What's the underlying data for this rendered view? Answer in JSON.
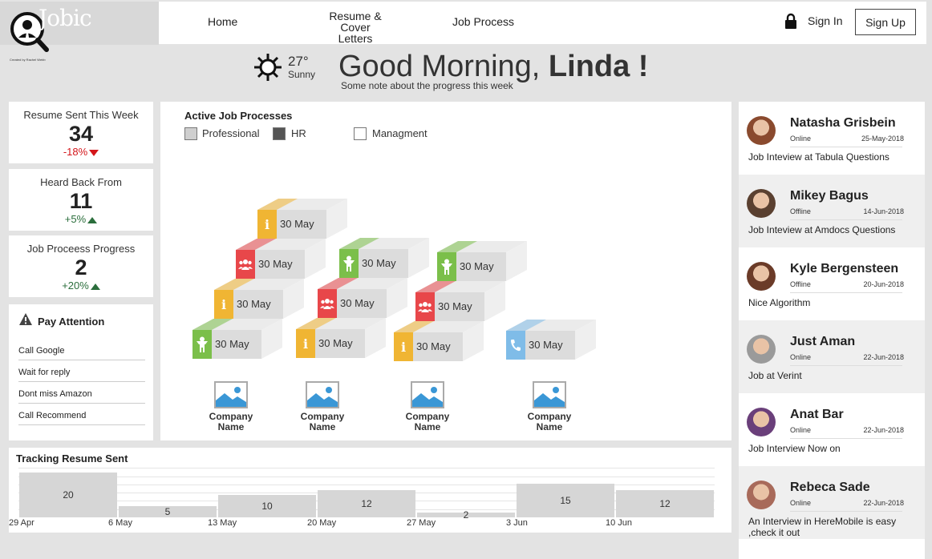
{
  "brand": {
    "name": "Jobic",
    "tagline": "Created by Rachel Webb"
  },
  "nav": {
    "home": "Home",
    "resume_line1": "Resume &",
    "resume_line2": "Cover Letters",
    "job_process": "Job Process",
    "sign_in": "Sign In",
    "sign_up": "Sign Up"
  },
  "weather": {
    "temp": "27°",
    "condition": "Sunny"
  },
  "greeting": {
    "prefix": "Good Morning, ",
    "name": "Linda !",
    "note": "Some note about the progress this week"
  },
  "stats": [
    {
      "title": "Resume Sent This Week",
      "value": "34",
      "change": "-18%",
      "direction": "down"
    },
    {
      "title": "Heard Back From",
      "value": "11",
      "change": "+5%",
      "direction": "up"
    },
    {
      "title": "Job Proceess Progress",
      "value": "2",
      "change": "+20%",
      "direction": "up"
    }
  ],
  "attention": {
    "title": "Pay Attention",
    "items": [
      "Call Google",
      "Wait for reply",
      "Dont miss Amazon",
      "Call Recommend"
    ]
  },
  "processes": {
    "title": "Active Job Processes",
    "legend": [
      "Professional",
      "HR",
      "Managment"
    ],
    "step_label": "30 May",
    "company_label_1": "Company",
    "company_label_2": "Name",
    "colors": {
      "info": "#f0b533",
      "hr": "#e8474a",
      "person": "#7bbf4a",
      "phone": "#7fbce8"
    }
  },
  "people": [
    {
      "name": "Natasha Grisbein",
      "status": "Online",
      "date": "25-May-2018",
      "note": "Job Inteview at Tabula Questions"
    },
    {
      "name": "Mikey Bagus",
      "status": "Offline",
      "date": "14-Jun-2018",
      "note": "Job Inteview at Amdocs Questions"
    },
    {
      "name": "Kyle Bergensteen",
      "status": "Offline",
      "date": "20-Jun-2018",
      "note": "Nice Algorithm"
    },
    {
      "name": "Just Aman",
      "status": "Online",
      "date": "22-Jun-2018",
      "note": "Job at Verint"
    },
    {
      "name": "Anat Bar",
      "status": "Online",
      "date": "22-Jun-2018",
      "note": "Job Interview Now on"
    },
    {
      "name": "Rebeca Sade",
      "status": "Online",
      "date": "22-Jun-2018",
      "note": "An Interview in HereMobile is easy ,check it out"
    }
  ],
  "tracking": {
    "title": "Tracking Resume Sent",
    "chart_data": {
      "type": "bar",
      "categories": [
        "29 Apr",
        "6 May",
        "13 May",
        "20 May",
        "27 May",
        "3 Jun",
        "10 Jun"
      ],
      "values": [
        20,
        5,
        10,
        12,
        2,
        15,
        12
      ],
      "ylim": [
        0,
        22
      ],
      "grid": true
    }
  }
}
